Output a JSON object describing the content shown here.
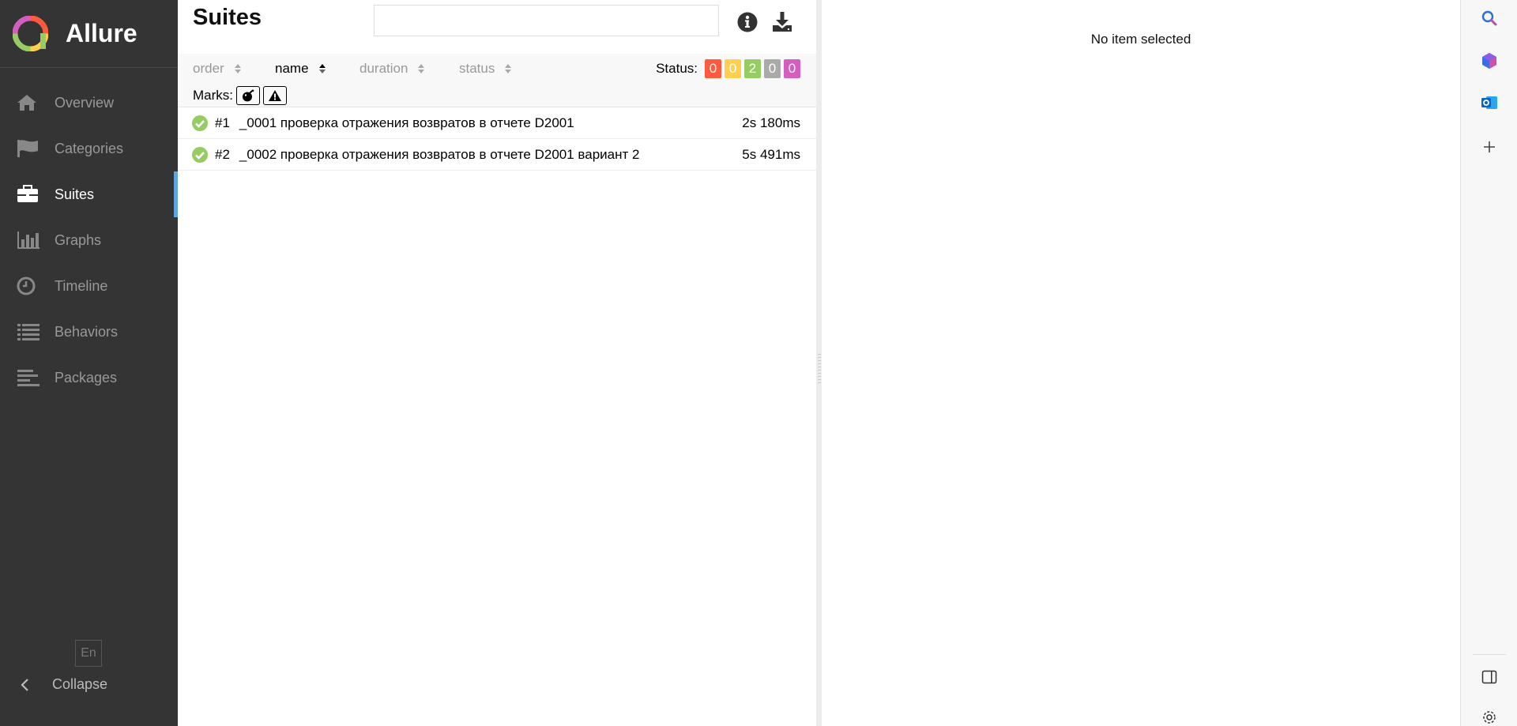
{
  "app": {
    "name": "Allure"
  },
  "sidebar": {
    "items": [
      {
        "label": "Overview",
        "icon": "home-icon"
      },
      {
        "label": "Categories",
        "icon": "flag-icon"
      },
      {
        "label": "Suites",
        "icon": "briefcase-icon",
        "active": true
      },
      {
        "label": "Graphs",
        "icon": "bar-chart-icon"
      },
      {
        "label": "Timeline",
        "icon": "clock-icon"
      },
      {
        "label": "Behaviors",
        "icon": "list-icon"
      },
      {
        "label": "Packages",
        "icon": "align-left-icon"
      }
    ],
    "language": "En",
    "collapse_label": "Collapse"
  },
  "suites": {
    "title": "Suites",
    "search": {
      "value": "",
      "placeholder": ""
    },
    "sorters": [
      {
        "label": "order",
        "active": false
      },
      {
        "label": "name",
        "active": true
      },
      {
        "label": "duration",
        "active": false
      },
      {
        "label": "status",
        "active": false
      }
    ],
    "status_label": "Status:",
    "status_counts": [
      {
        "status": "failed",
        "count": "0",
        "color": "#fd5a3e"
      },
      {
        "status": "broken",
        "count": "0",
        "color": "#ffd050"
      },
      {
        "status": "passed",
        "count": "2",
        "color": "#97cc64"
      },
      {
        "status": "skipped",
        "count": "0",
        "color": "#aaaaaa"
      },
      {
        "status": "unknown",
        "count": "0",
        "color": "#d35ebe"
      }
    ],
    "marks_label": "Marks:",
    "marks": [
      "bomb-icon",
      "warning-icon"
    ],
    "tests": [
      {
        "num": "#1",
        "name": "_0001 проверка отражения возвратов в отчете D2001",
        "duration": "2s 180ms",
        "status": "passed"
      },
      {
        "num": "#2",
        "name": "_0002 проверка отражения возвратов в отчете D2001 вариант 2",
        "duration": "5s 491ms",
        "status": "passed"
      }
    ]
  },
  "detail": {
    "empty_message": "No item selected"
  },
  "colors": {
    "sidebar_bg": "#343434",
    "active_accent": "#5fa5e0",
    "passed": "#97cc64"
  }
}
